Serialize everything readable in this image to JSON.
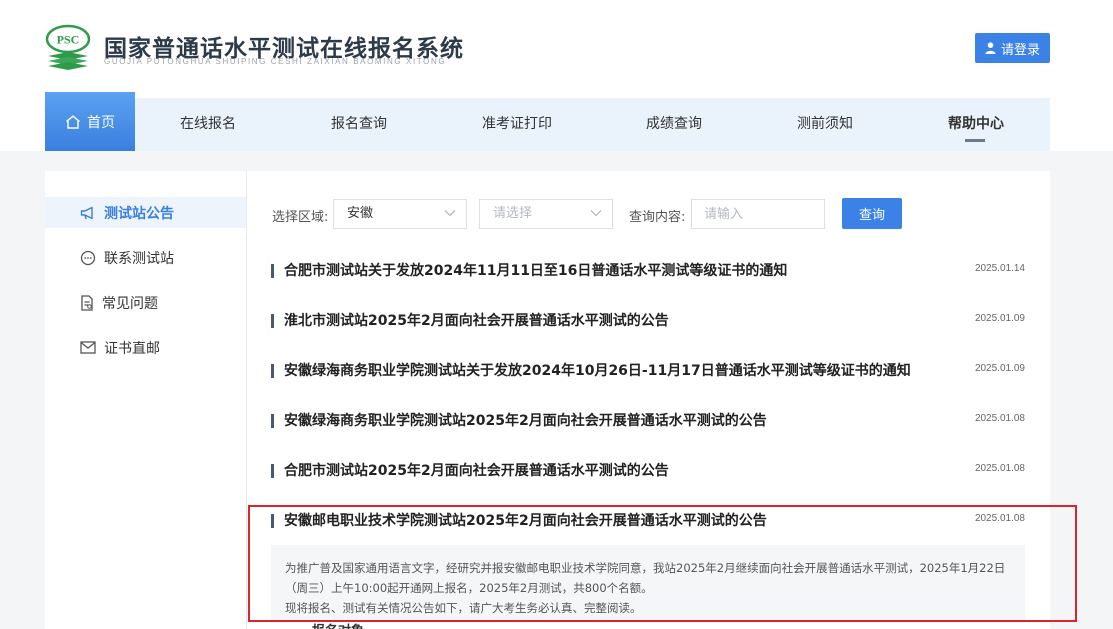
{
  "header": {
    "logo_text": "PSC",
    "title": "国家普通话水平测试在线报名系统",
    "subtitle": "GUOJIA PUTONGHUA SHUIPING CESHI ZAIXIAN BAOMING XITONG",
    "login_label": "请登录"
  },
  "nav": {
    "home": "首页",
    "items": [
      "在线报名",
      "报名查询",
      "准考证打印",
      "成绩查询",
      "测前须知",
      "帮助中心"
    ]
  },
  "sidebar": {
    "items": [
      "测试站公告",
      "联系测试站",
      "常见问题",
      "证书直邮"
    ]
  },
  "filters": {
    "region_label": "选择区域:",
    "region_value": "安徽",
    "sub_placeholder": "请选择",
    "query_label": "查询内容:",
    "query_placeholder": "请输入",
    "search_button": "查询"
  },
  "notices": [
    {
      "title": "合肥市测试站关于发放2024年11月11日至16日普通话水平测试等级证书的通知",
      "date": "2025.01.14"
    },
    {
      "title": "淮北市测试站2025年2月面向社会开展普通话水平测试的公告",
      "date": "2025.01.09"
    },
    {
      "title": "安徽绿海商务职业学院测试站关于发放2024年10月26日-11月17日普通话水平测试等级证书的通知",
      "date": "2025.01.09"
    },
    {
      "title": "安徽绿海商务职业学院测试站2025年2月面向社会开展普通话水平测试的公告",
      "date": "2025.01.08"
    },
    {
      "title": "合肥市测试站2025年2月面向社会开展普通话水平测试的公告",
      "date": "2025.01.08"
    },
    {
      "title": "安徽邮电职业技术学院测试站2025年2月面向社会开展普通话水平测试的公告",
      "date": "2025.01.08"
    }
  ],
  "excerpt": {
    "line1": "为推广普及国家通用语言文字，经研究并报安徽邮电职业技术学院同意，我站2025年2月继续面向社会开展普通话水平测试，2025年1月22日",
    "line2": "（周三）上午10:00起开通网上报名，2025年2月测试，共800个名额。",
    "line3": "现将报名、测试有关情况公告如下，请广大考生务必认真、完整阅读。"
  },
  "next_section": "一、报名对象",
  "colors": {
    "accent": "#3b82e6",
    "highlight_border": "#d9252b",
    "logo_green": "#2f9a4a"
  }
}
